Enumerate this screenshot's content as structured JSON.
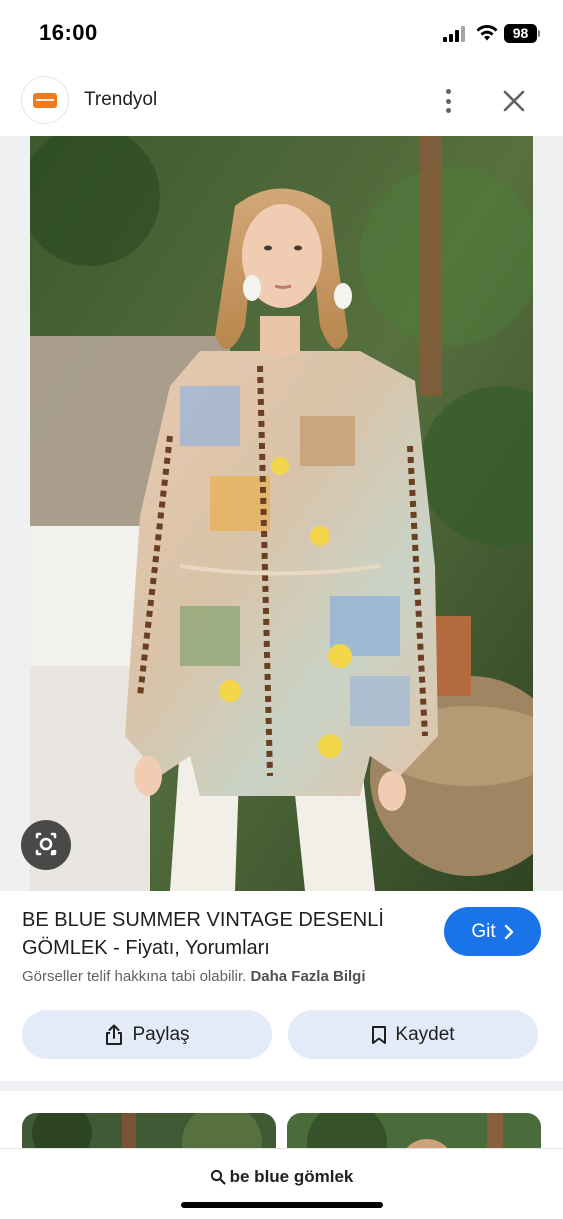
{
  "status_bar": {
    "time": "16:00",
    "battery": "98"
  },
  "header": {
    "site_name": "Trendyol",
    "logo_icon": "trendyol-logo",
    "more_icon": "more-vert-icon",
    "close_icon": "close-icon"
  },
  "image": {
    "lens_icon": "google-lens-icon"
  },
  "result": {
    "title": "BE BLUE SUMMER VINTAGE DESENLİ GÖMLEK - Fiyatı, Yorumları",
    "visit_label": "Git",
    "copyright_text": "Görseller telif hakkına tabi olabilir.",
    "more_info_link": "Daha Fazla Bilgi"
  },
  "actions": {
    "share_label": "Paylaş",
    "save_label": "Kaydet"
  },
  "bottom": {
    "search_query": "be blue gömlek"
  },
  "colors": {
    "accent": "#1a73e8",
    "action_bg": "#e3ebf9",
    "brand": "#f27a1a"
  }
}
